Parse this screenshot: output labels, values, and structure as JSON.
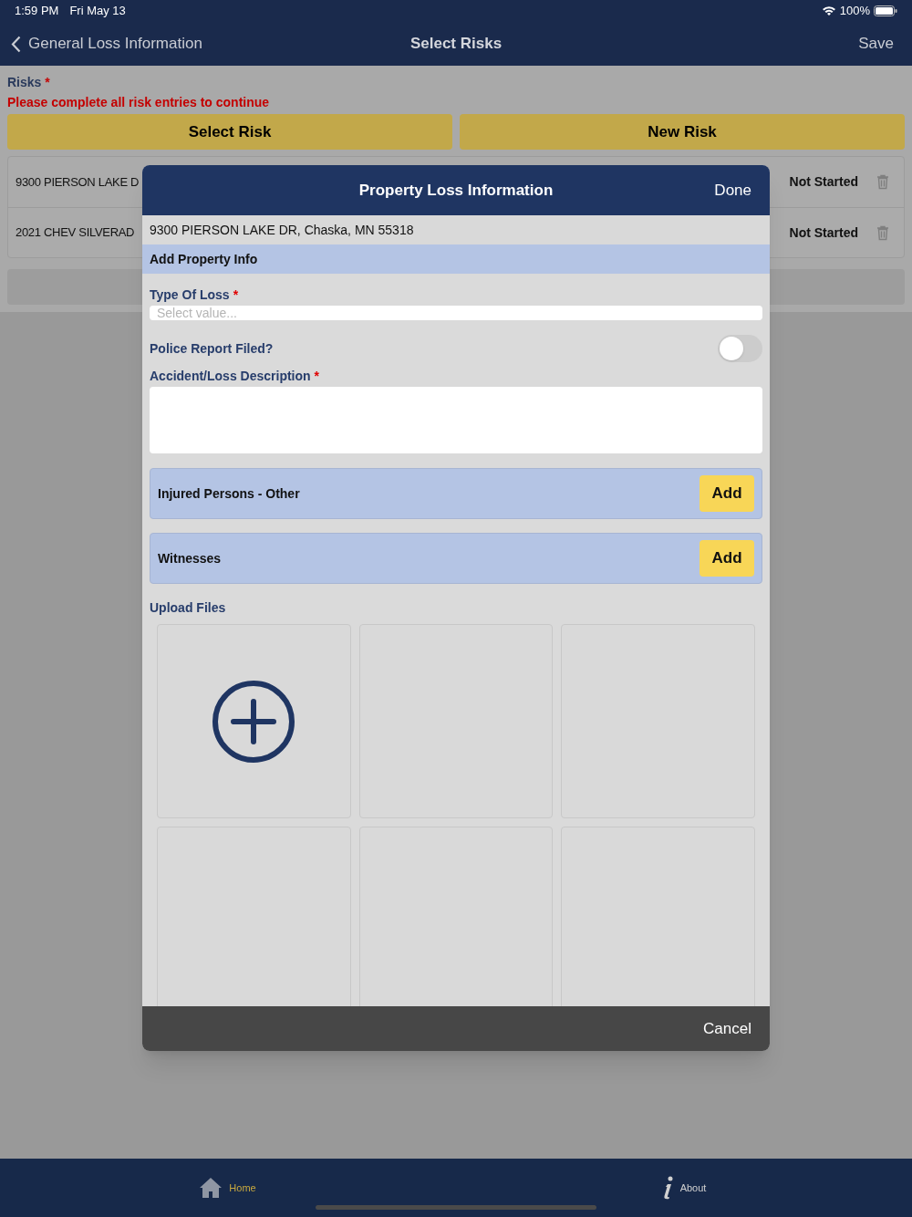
{
  "status_bar": {
    "time": "1:59 PM",
    "date": "Fri May 13",
    "battery": "100%"
  },
  "nav": {
    "back_label": "General Loss Information",
    "title": "Select Risks",
    "action": "Save"
  },
  "risks": {
    "label": "Risks",
    "required_mark": "*",
    "error": "Please complete all risk entries to continue"
  },
  "buttons": [
    "Select Risk",
    "New Risk"
  ],
  "risk_rows": [
    {
      "name": "9300 PIERSON LAKE D",
      "status": "Not Started"
    },
    {
      "name": "2021 CHEV SILVERAD",
      "status": "Not Started"
    }
  ],
  "modal": {
    "title": "Property Loss Information",
    "done": "Done",
    "address": "9300 PIERSON LAKE DR, Chaska, MN 55318",
    "section": "Add Property Info",
    "fields": [
      {
        "kind": "select",
        "label": "Type Of Loss",
        "required_mark": "*",
        "placeholder": "Select value..."
      },
      {
        "kind": "toggle",
        "label": "Police Report Filed?",
        "on": false
      },
      {
        "kind": "textarea",
        "label": "Accident/Loss Description",
        "required_mark": "*"
      }
    ],
    "lists": [
      {
        "label": "Injured Persons - Other",
        "button": "Add"
      },
      {
        "label": "Witnesses",
        "button": "Add"
      }
    ],
    "upload_label": "Upload Files",
    "cancel": "Cancel"
  },
  "tab_bar": [
    {
      "label": "Home",
      "selected": true
    },
    {
      "label": "About",
      "selected": false
    }
  ]
}
